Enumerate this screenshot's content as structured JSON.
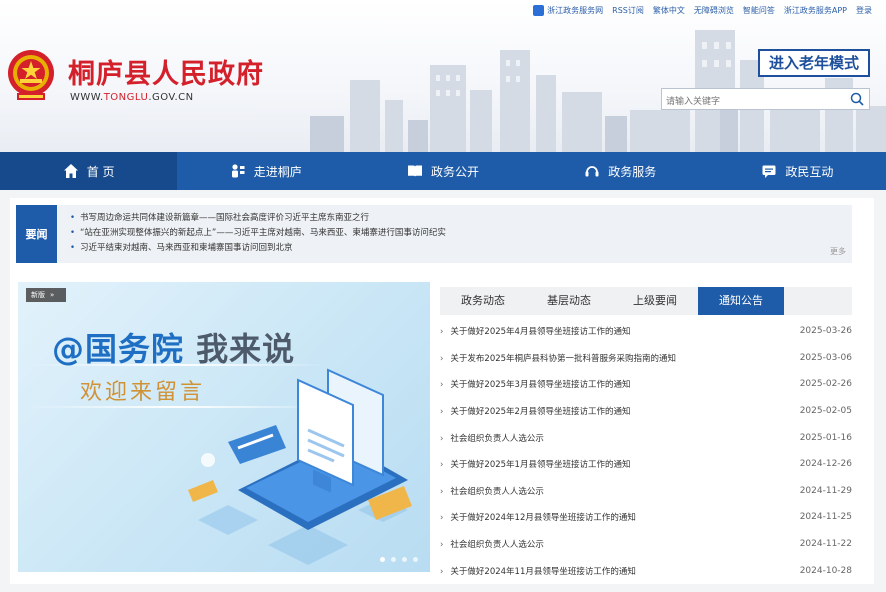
{
  "top_links": [
    {
      "label": "浙江政务服务网",
      "icon": "zhejiang-service-icon"
    },
    {
      "label": "RSS订阅"
    },
    {
      "label": "繁体中文"
    },
    {
      "label": "无障碍浏览"
    },
    {
      "label": "智能问答"
    },
    {
      "label": "浙江政务服务APP"
    },
    {
      "label": "登录"
    }
  ],
  "site": {
    "title": "桐庐县人民政府",
    "url_prefix": "WWW.",
    "url_highlight": "TONGLU",
    "url_suffix": ".GOV.CN",
    "emblem_icon": "national-emblem-icon"
  },
  "elder_mode_label": "进入老年模式",
  "search": {
    "placeholder": "请输入关键字",
    "icon": "search-icon"
  },
  "nav": [
    {
      "label": "首 页",
      "icon": "home-icon",
      "active": true
    },
    {
      "label": "走进桐庐",
      "icon": "people-icon"
    },
    {
      "label": "政务公开",
      "icon": "book-icon"
    },
    {
      "label": "政务服务",
      "icon": "service-icon"
    },
    {
      "label": "政民互动",
      "icon": "chat-icon"
    }
  ],
  "headline_news": {
    "label": "要闻",
    "items": [
      "书写周边命运共同体建设新篇章——国际社会高度评价习近平主席东南亚之行",
      "“站在亚洲实现整体振兴的新起点上”——习近平主席对越南、马来西亚、柬埔寨进行国事访问纪实",
      "习近平结束对越南、马来西亚和柬埔寨国事访问回到北京"
    ],
    "more": "更多"
  },
  "banner": {
    "tag": "新版",
    "title_blue": "@国务院",
    "title_gray": "我来说",
    "subtitle": "欢迎来留言",
    "slide_count": 4
  },
  "tabs": [
    {
      "label": "政务动态"
    },
    {
      "label": "基层动态"
    },
    {
      "label": "上级要闻"
    },
    {
      "label": "通知公告",
      "active": true
    }
  ],
  "notices": [
    {
      "title": "关于做好2025年4月县领导坐班接访工作的通知",
      "date": "2025-03-26"
    },
    {
      "title": "关于发布2025年桐庐县科协第一批科普服务采购指南的通知",
      "date": "2025-03-06"
    },
    {
      "title": "关于做好2025年3月县领导坐班接访工作的通知",
      "date": "2025-02-26"
    },
    {
      "title": "关于做好2025年2月县领导坐班接访工作的通知",
      "date": "2025-02-05"
    },
    {
      "title": "社会组织负责人人选公示",
      "date": "2025-01-16"
    },
    {
      "title": "关于做好2025年1月县领导坐班接访工作的通知",
      "date": "2024-12-26"
    },
    {
      "title": "社会组织负责人人选公示",
      "date": "2024-11-29"
    },
    {
      "title": "关于做好2024年12月县领导坐班接访工作的通知",
      "date": "2024-11-25"
    },
    {
      "title": "社会组织负责人人选公示",
      "date": "2024-11-22"
    },
    {
      "title": "关于做好2024年11月县领导坐班接访工作的通知",
      "date": "2024-10-28"
    }
  ],
  "colors": {
    "brand_blue": "#1e5ba8",
    "title_red": "#d4202a"
  }
}
